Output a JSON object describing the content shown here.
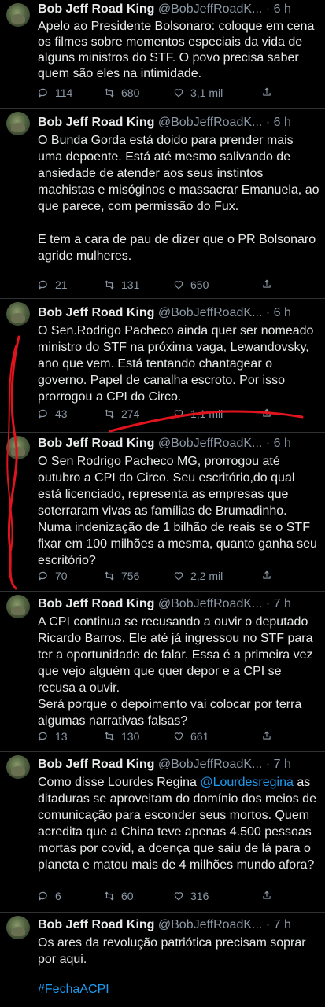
{
  "tweets": [
    {
      "name": "Bob Jeff Road King",
      "handle": "@BobJeffRoadK...",
      "time": "6 h",
      "text": "Apelo ao Presidente Bolsonaro: coloque em cena os filmes sobre momentos especiais da vida de alguns ministros do STF. O povo precisa saber quem são eles na intimidade.",
      "replies": "114",
      "retweets": "680",
      "likes": "3,1 mil"
    },
    {
      "name": "Bob Jeff Road King",
      "handle": "@BobJeffRoadK...",
      "time": "6 h",
      "text": "O Bunda Gorda está doido para prender mais uma depoente. Está até mesmo salivando de ansiedade de atender aos seus instintos machistas e misóginos e massacrar Emanuela, ao que parece, com permissão do Fux.\n\nE tem a cara de pau de dizer que o PR Bolsonaro agride mulheres.",
      "replies": "21",
      "retweets": "131",
      "likes": "650"
    },
    {
      "name": "Bob Jeff Road King",
      "handle": "@BobJeffRoadK...",
      "time": "6 h",
      "text": "O Sen.Rodrigo Pacheco ainda quer ser nomeado ministro do STF na próxima vaga, Lewandovsky, ano que vem. Está tentando chantagear o governo. Papel de canalha escroto. Por isso prorrogou a CPI do Circo.",
      "replies": "43",
      "retweets": "274",
      "likes": "1,1 mil"
    },
    {
      "name": "Bob Jeff Road King",
      "handle": "@BobJeffRoadK...",
      "time": "6 h",
      "text": "O Sen Rodrigo Pacheco MG, prorrogou até outubro a CPI do Circo. Seu escritório,do qual está licenciado, representa as empresas que soterraram vivas as famílias de Brumadinho. Numa indenização de 1 bilhão de reais se o STF fixar em 100 milhões a mesma, quanto ganha seu escritório?",
      "replies": "70",
      "retweets": "756",
      "likes": "2,2 mil"
    },
    {
      "name": "Bob Jeff Road King",
      "handle": "@BobJeffRoadK...",
      "time": "7 h",
      "text": "A CPI continua se recusando a ouvir o deputado Ricardo Barros. Ele até já ingressou no STF para ter a oportunidade de falar. Essa é a primeira vez que vejo alguém que quer depor e a CPI se recusa a ouvir.\nSerá porque o depoimento vai colocar por terra algumas narrativas falsas?",
      "replies": "13",
      "retweets": "130",
      "likes": "661"
    },
    {
      "name": "Bob Jeff Road King",
      "handle": "@BobJeffRoadK...",
      "time": "7 h",
      "text_before": "Como disse Lourdes Regina ",
      "mention": "@Lourdesregina",
      "text_after": " as ditaduras se aproveitam do domínio dos meios de comunicação para esconder seus mortos. Quem acredita que a China teve apenas 4.500 pessoas mortas por covid, a doença que saiu de lá para o planeta e matou mais de 4 milhões mundo afora?",
      "replies": "6",
      "retweets": "60",
      "likes": "316"
    },
    {
      "name": "Bob Jeff Road King",
      "handle": "@BobJeffRoadK...",
      "time": "7 h",
      "text": "Os ares da revolução patriótica precisam soprar por aqui.",
      "hashtag": "#FechaACPI"
    }
  ],
  "colors": {
    "background": "#000000",
    "text": "#e7e9ea",
    "muted": "#8b98a5",
    "link": "#1d9bf0",
    "annotation": "#e0141e"
  }
}
